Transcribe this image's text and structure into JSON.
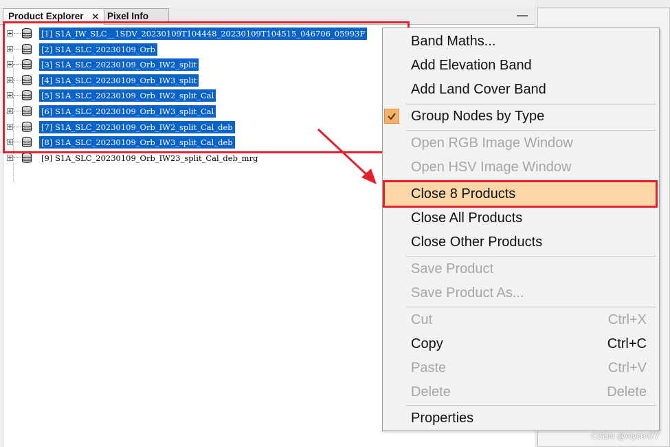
{
  "tabs": {
    "product_explorer": "Product Explorer",
    "close_glyph": "✕",
    "pixel_info": "Pixel Info",
    "minimize_glyph": "—"
  },
  "tree": {
    "items": [
      {
        "label": "[1] S1A_IW_SLC__1SDV_20230109T104448_20230109T104515_046706_05993F",
        "selected": true,
        "icon": "database-icon"
      },
      {
        "label": "[2] S1A_SLC_20230109_Orb",
        "selected": true,
        "icon": "database-icon"
      },
      {
        "label": "[3] S1A_SLC_20230109_Orb_IW2_split",
        "selected": true,
        "icon": "database-icon"
      },
      {
        "label": "[4] S1A_SLC_20230109_Orb_IW3_split",
        "selected": true,
        "icon": "database-icon"
      },
      {
        "label": "[5] S1A_SLC_20230109_Orb_IW2_split_Cal",
        "selected": true,
        "icon": "database-icon"
      },
      {
        "label": "[6] S1A_SLC_20230109_Orb_IW3_split_Cal",
        "selected": true,
        "icon": "database-icon"
      },
      {
        "label": "[7] S1A_SLC_20230109_Orb_IW2_split_Cal_deb",
        "selected": true,
        "icon": "database-icon"
      },
      {
        "label": "[8] S1A_SLC_20230109_Orb_IW3_split_Cal_deb",
        "selected": true,
        "icon": "database-icon"
      },
      {
        "label": "[9] S1A_SLC_20230109_Orb_IW23_split_Cal_deb_mrg",
        "selected": false,
        "icon": "database-icon"
      }
    ]
  },
  "menu": {
    "band_maths": "Band Maths...",
    "add_elevation_band": "Add Elevation Band",
    "add_land_cover_band": "Add Land Cover Band",
    "group_nodes_by_type": "Group Nodes by Type",
    "group_nodes_checked": true,
    "open_rgb": "Open RGB Image Window",
    "open_hsv": "Open HSV Image Window",
    "close_8_products": "Close 8 Products",
    "close_all_products": "Close All Products",
    "close_other_products": "Close Other Products",
    "save_product": "Save Product",
    "save_product_as": "Save Product As...",
    "cut": "Cut",
    "cut_shortcut": "Ctrl+X",
    "copy": "Copy",
    "copy_shortcut": "Ctrl+C",
    "paste": "Paste",
    "paste_shortcut": "Ctrl+V",
    "delete": "Delete",
    "delete_shortcut": "Delete",
    "properties": "Properties"
  },
  "colors": {
    "selection": "#0a63c9",
    "highlight_box": "#e4202b",
    "menu_hover": "#fbd6a6",
    "checkbox": "#f6b26b"
  },
  "watermark": "CSDN @Alyson77"
}
